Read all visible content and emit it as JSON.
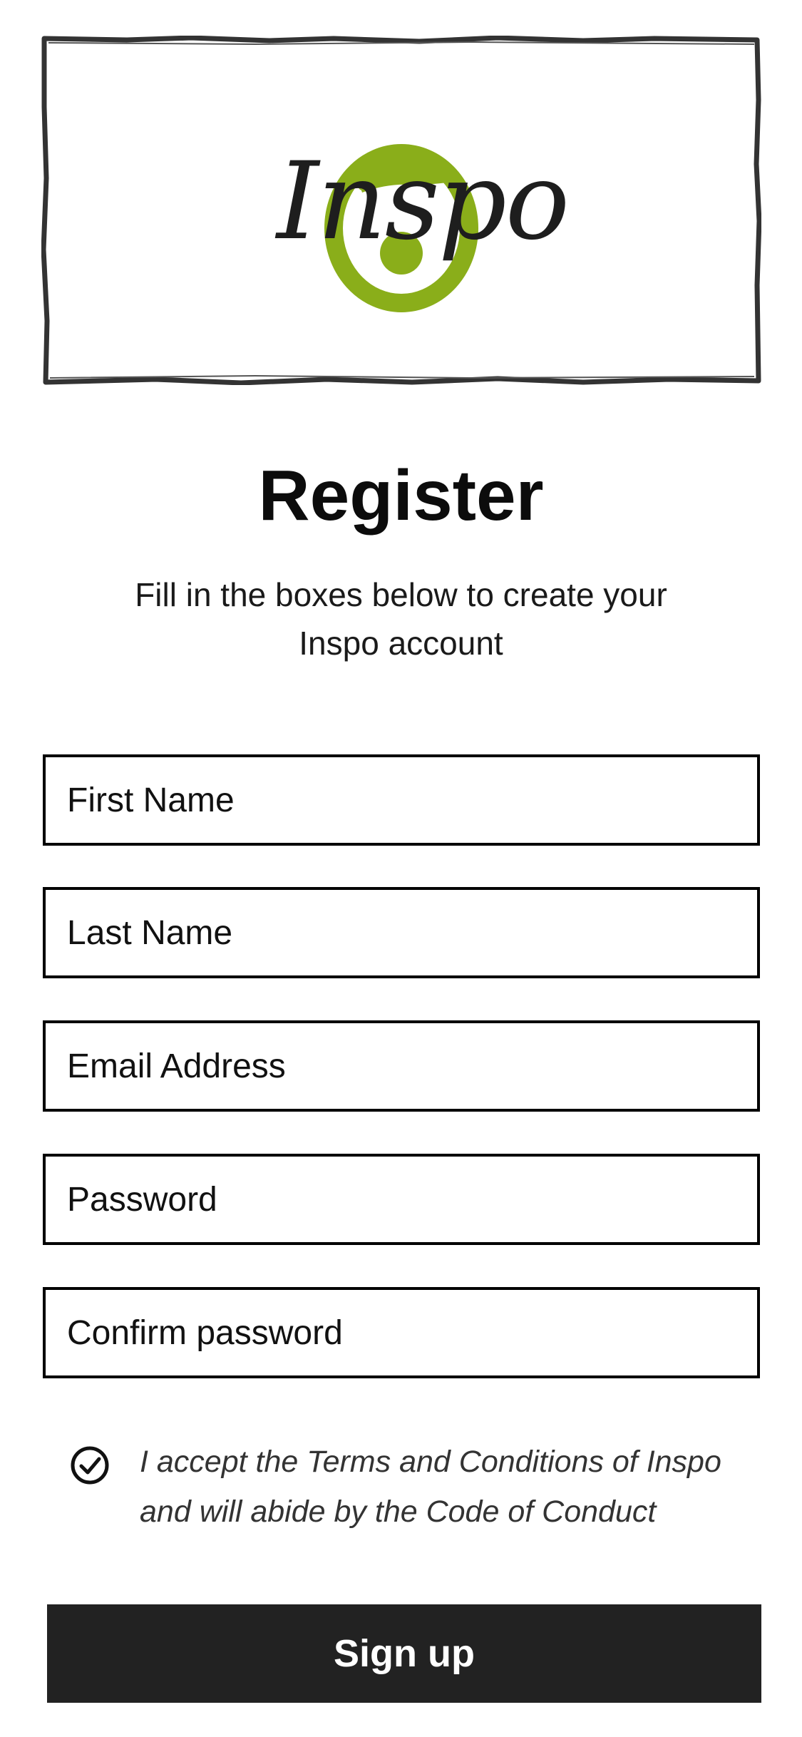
{
  "logo": {
    "icon": "inspo-logo",
    "wordmark": "Inspo",
    "accent_color": "#8aae1a",
    "ink_color": "#1e1e1e"
  },
  "register": {
    "title": "Register",
    "subtitle": "Fill in the boxes below to create your Inspo account"
  },
  "form": {
    "first_name_placeholder": "First Name",
    "last_name_placeholder": "Last Name",
    "email_placeholder": "Email Address",
    "password_placeholder": "Password",
    "confirm_password_placeholder": "Confirm password"
  },
  "terms": {
    "checked": true,
    "icon": "check-circle-icon",
    "text": "I accept the Terms and Conditions of Inspo and will abide by the Code of Conduct"
  },
  "actions": {
    "signup_label": "Sign up",
    "button_color": "#222222"
  }
}
